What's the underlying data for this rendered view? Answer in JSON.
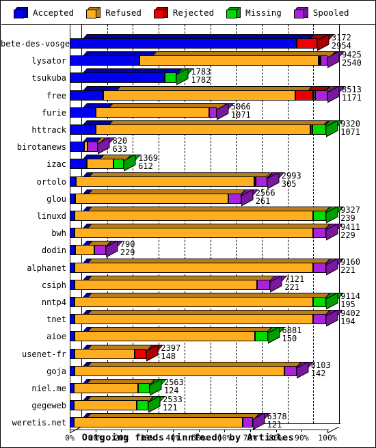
{
  "legend": {
    "items": [
      {
        "label": "Accepted",
        "color": "#0000ee"
      },
      {
        "label": "Refused",
        "color": "#ffae20"
      },
      {
        "label": "Rejected",
        "color": "#ee0000"
      },
      {
        "label": "Missing",
        "color": "#00dd00"
      },
      {
        "label": "Spooled",
        "color": "#aa22dd"
      }
    ]
  },
  "chart_data": {
    "type": "bar",
    "orientation": "horizontal",
    "stacked": true,
    "percent_of_total": true,
    "title": "Outgoing feeds (innfeed) by Articles",
    "xlabel": "Outgoing feeds (innfeed) by Articles",
    "ylabel": "",
    "xlim": [
      0,
      100
    ],
    "xticks": [
      "0%",
      "10%",
      "20%",
      "30%",
      "40%",
      "50%",
      "60%",
      "70%",
      "80%",
      "90%",
      "100%"
    ],
    "grid": true,
    "grid_style": "dashed-vertical",
    "legend_position": "top",
    "series": [
      {
        "name": "Accepted",
        "color": "#0000ee"
      },
      {
        "name": "Refused",
        "color": "#ffae20"
      },
      {
        "name": "Rejected",
        "color": "#ee0000"
      },
      {
        "name": "Missing",
        "color": "#00dd00"
      },
      {
        "name": "Spooled",
        "color": "#aa22dd"
      }
    ],
    "categories": [
      "bete-des-vosges",
      "lysator",
      "tsukuba",
      "free",
      "furie",
      "httrack",
      "birotanews",
      "izac",
      "ortolo",
      "glou",
      "linuxd",
      "bwh",
      "dodin",
      "alphanet",
      "csiph",
      "nntp4",
      "tnet",
      "aioe",
      "usenet-fr",
      "goja",
      "niel.me",
      "gegeweb",
      "weretis.net"
    ],
    "rows": [
      {
        "category": "bete-des-vosges",
        "top_value": "3172",
        "bottom_value": "2954",
        "pct": [
          88.0,
          0.0,
          8.0,
          0.0,
          0.0
        ],
        "total_pct": 96.0
      },
      {
        "category": "lysator",
        "top_value": "9425",
        "bottom_value": "2540",
        "pct": [
          27.0,
          69.5,
          0.3,
          0.6,
          2.6
        ],
        "total_pct": 100.0
      },
      {
        "category": "tsukuba",
        "top_value": "1783",
        "bottom_value": "1782",
        "pct": [
          37.0,
          0.0,
          0.0,
          4.5,
          0.0
        ],
        "total_pct": 41.5
      },
      {
        "category": "free",
        "top_value": "8513",
        "bottom_value": "1171",
        "pct": [
          13.0,
          74.5,
          7.0,
          0.6,
          5.0
        ],
        "total_pct": 100.0
      },
      {
        "category": "furie",
        "top_value": "5066",
        "bottom_value": "1071",
        "pct": [
          10.0,
          44.0,
          0.0,
          0.0,
          3.0
        ],
        "total_pct": 57.0
      },
      {
        "category": "httrack",
        "top_value": "9320",
        "bottom_value": "1071",
        "pct": [
          10.0,
          83.5,
          0.7,
          5.3,
          0.0
        ],
        "total_pct": 99.5
      },
      {
        "category": "birotanews",
        "top_value": "820",
        "bottom_value": "633",
        "pct": [
          5.5,
          1.5,
          0.0,
          0.0,
          4.0
        ],
        "total_pct": 11.0
      },
      {
        "category": "izac",
        "top_value": "1369",
        "bottom_value": "612",
        "pct": [
          6.5,
          10.5,
          0.0,
          4.0,
          0.0
        ],
        "total_pct": 21.0
      },
      {
        "category": "ortolo",
        "top_value": "2993",
        "bottom_value": "305",
        "pct": [
          2.5,
          69.0,
          0.6,
          0.0,
          4.5
        ],
        "total_pct": 76.6
      },
      {
        "category": "glou",
        "top_value": "2566",
        "bottom_value": "261",
        "pct": [
          2.0,
          59.5,
          0.0,
          0.0,
          5.0
        ],
        "total_pct": 66.5
      },
      {
        "category": "linuxd",
        "top_value": "9327",
        "bottom_value": "239",
        "pct": [
          1.8,
          92.5,
          0.0,
          5.2,
          0.0
        ],
        "total_pct": 99.5
      },
      {
        "category": "bwh",
        "top_value": "9411",
        "bottom_value": "229",
        "pct": [
          1.8,
          92.7,
          0.0,
          0.0,
          5.0
        ],
        "total_pct": 99.5
      },
      {
        "category": "dodin",
        "top_value": "790",
        "bottom_value": "229",
        "pct": [
          2.0,
          7.5,
          0.0,
          0.0,
          4.5
        ],
        "total_pct": 14.0
      },
      {
        "category": "alphanet",
        "top_value": "9160",
        "bottom_value": "221",
        "pct": [
          1.8,
          92.5,
          0.0,
          0.0,
          5.2
        ],
        "total_pct": 99.5
      },
      {
        "category": "csiph",
        "top_value": "7121",
        "bottom_value": "221",
        "pct": [
          1.8,
          71.0,
          0.0,
          0.0,
          5.0
        ],
        "total_pct": 77.8
      },
      {
        "category": "nntp4",
        "top_value": "9114",
        "bottom_value": "195",
        "pct": [
          1.8,
          92.5,
          0.0,
          5.2,
          0.0
        ],
        "total_pct": 99.5
      },
      {
        "category": "tnet",
        "top_value": "9402",
        "bottom_value": "194",
        "pct": [
          1.8,
          92.7,
          0.0,
          0.0,
          5.0
        ],
        "total_pct": 99.5
      },
      {
        "category": "aioe",
        "top_value": "6881",
        "bottom_value": "150",
        "pct": [
          1.8,
          70.0,
          0.0,
          5.0,
          0.0
        ],
        "total_pct": 76.8
      },
      {
        "category": "usenet-fr",
        "top_value": "2397",
        "bottom_value": "148",
        "pct": [
          1.8,
          23.5,
          4.5,
          0.0,
          0.0
        ],
        "total_pct": 29.8
      },
      {
        "category": "goja",
        "top_value": "8103",
        "bottom_value": "142",
        "pct": [
          1.8,
          81.5,
          0.0,
          0.0,
          4.7
        ],
        "total_pct": 88.0
      },
      {
        "category": "niel.me",
        "top_value": "2563",
        "bottom_value": "124",
        "pct": [
          1.5,
          25.0,
          0.0,
          4.5,
          0.0
        ],
        "total_pct": 31.0
      },
      {
        "category": "gegeweb",
        "top_value": "2533",
        "bottom_value": "121",
        "pct": [
          1.5,
          24.5,
          0.0,
          4.5,
          0.0
        ],
        "total_pct": 30.5
      },
      {
        "category": "weretis.net",
        "top_value": "6378",
        "bottom_value": "121",
        "pct": [
          1.5,
          65.5,
          0.0,
          0.0,
          4.0
        ],
        "total_pct": 71.0
      }
    ]
  }
}
